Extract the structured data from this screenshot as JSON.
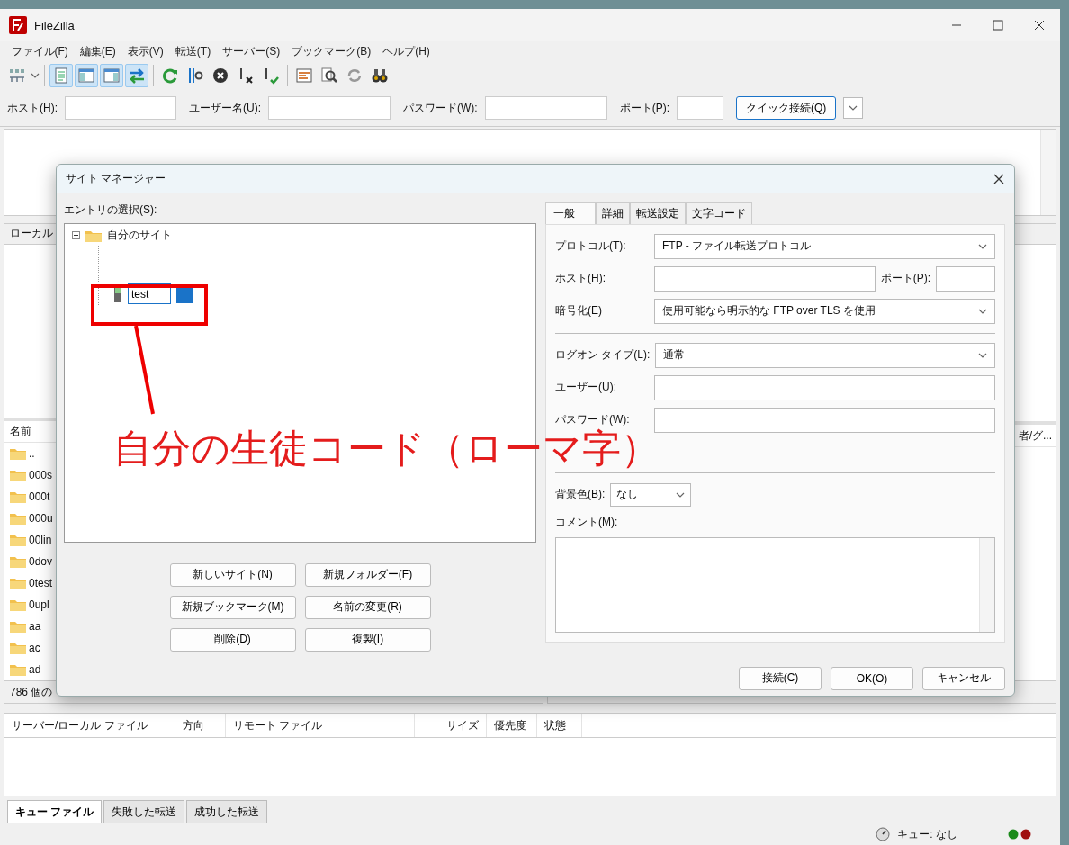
{
  "window": {
    "title": "FileZilla"
  },
  "menu": [
    "ファイル(F)",
    "編集(E)",
    "表示(V)",
    "転送(T)",
    "サーバー(S)",
    "ブックマーク(B)",
    "ヘルプ(H)"
  ],
  "toolbar": [
    {
      "pressed": false
    },
    {
      "pressed": true
    },
    {
      "pressed": true
    },
    {
      "pressed": true
    },
    {
      "pressed": true
    },
    {
      "pressed": false
    },
    {
      "pressed": false
    },
    {
      "pressed": false
    },
    {
      "pressed": false
    },
    {
      "pressed": false
    },
    {
      "pressed": false
    },
    {
      "pressed": false
    },
    {
      "pressed": false
    },
    {
      "pressed": false
    }
  ],
  "quickconnect": {
    "fields": [
      {
        "label": "ホスト(H):"
      },
      {
        "label": "ユーザー名(U):"
      },
      {
        "label": "パスワード(W):"
      },
      {
        "label": "ポート(P):"
      }
    ],
    "button": "クイック接続(Q)"
  },
  "local": {
    "label": "ローカル",
    "column": "名前",
    "files": [
      "..",
      "000s",
      "000t",
      "000u",
      "00lin",
      "0dov",
      "0test",
      "0upl",
      "aa",
      "ac",
      "ad"
    ],
    "status": "786 個の"
  },
  "remote": {
    "column": "者/グ..."
  },
  "queue": {
    "columns": [
      "サーバー/ローカル ファイル",
      "方向",
      "リモート ファイル",
      "サイズ",
      "優先度",
      "状態"
    ],
    "tabs": [
      {
        "label": "キュー ファイル",
        "selected": true
      },
      {
        "label": "失敗した転送",
        "selected": false
      },
      {
        "label": "成功した転送",
        "selected": false
      }
    ],
    "status": "キュー: なし"
  },
  "dialog": {
    "title": "サイト マネージャー",
    "tree_label": "エントリの選択(S):",
    "tree": [
      {
        "label": "自分のサイト",
        "expanded": true,
        "children": [
          {
            "label": "test"
          }
        ]
      }
    ],
    "buttons": [
      "新しいサイト(N)",
      "新規フォルダー(F)",
      "新規ブックマーク(M)",
      "名前の変更(R)",
      "削除(D)",
      "複製(I)"
    ],
    "tabs": [
      {
        "label": "一般",
        "selected": true
      },
      {
        "label": "詳細",
        "selected": false
      },
      {
        "label": "転送設定",
        "selected": false
      },
      {
        "label": "文字コード",
        "selected": false
      }
    ],
    "fields": [
      {
        "kind": "select",
        "label": "プロトコル(T):",
        "value": "FTP - ファイル転送プロトコル"
      },
      {
        "kind": "host",
        "label": "ホスト(H):",
        "port_label": "ポート(P):"
      },
      {
        "kind": "select",
        "label": "暗号化(E)",
        "value": "使用可能なら明示的な FTP over TLS を使用"
      },
      {
        "kind": "separator"
      },
      {
        "kind": "select",
        "label": "ログオン タイプ(L):",
        "value": "通常"
      },
      {
        "kind": "input",
        "label": "ユーザー(U):"
      },
      {
        "kind": "input",
        "label": "パスワード(W):"
      },
      {
        "kind": "separator"
      },
      {
        "kind": "small-select",
        "label": "背景色(B):",
        "value": "なし"
      },
      {
        "kind": "textarea",
        "label": "コメント(M):"
      }
    ],
    "footer_buttons": [
      "接続(C)",
      "OK(O)",
      "キャンセル"
    ]
  },
  "annotation": {
    "text": "自分の生徒コード（ローマ字）"
  }
}
